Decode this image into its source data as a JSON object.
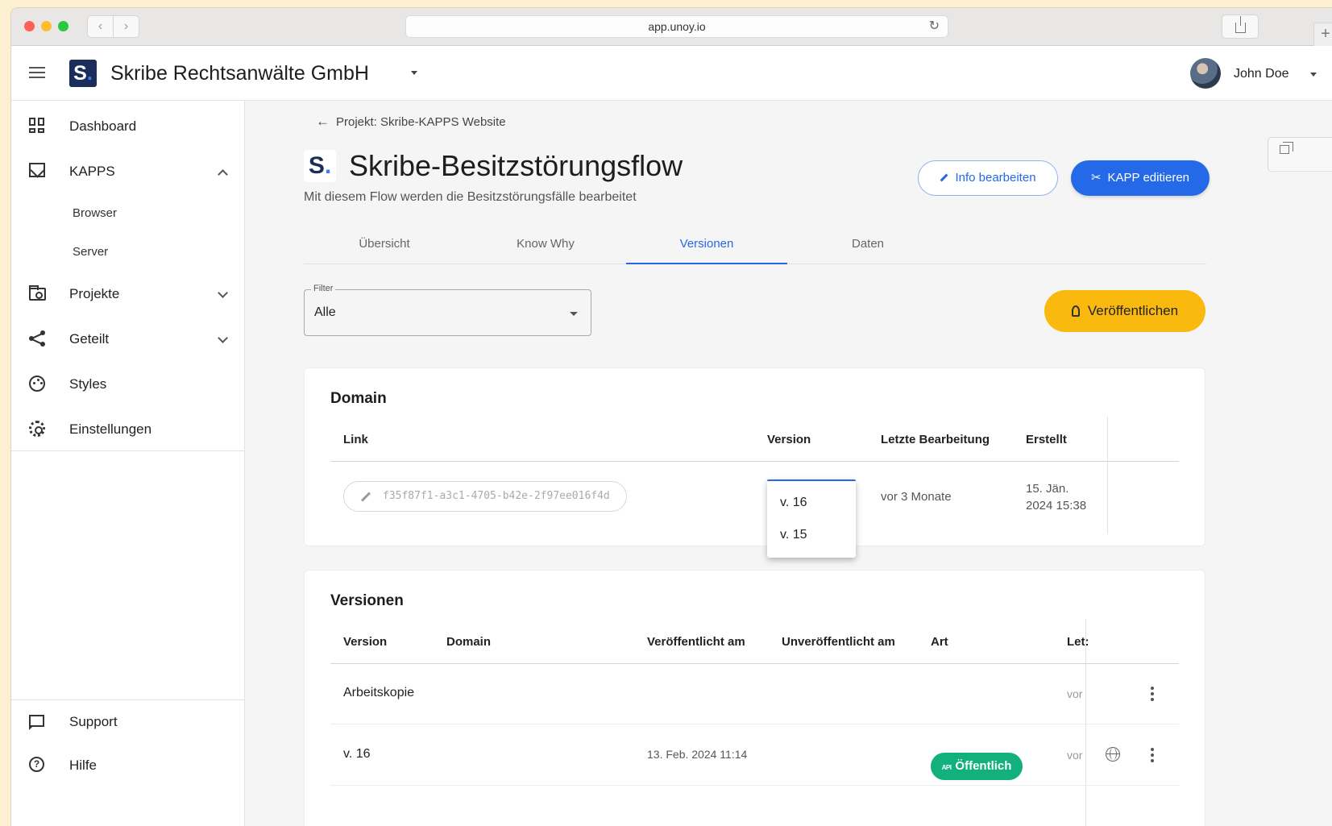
{
  "browser": {
    "url": "app.unoy.io",
    "back_glyph": "‹",
    "forward_glyph": "›",
    "reload_glyph": "↻",
    "new_tab_glyph": "+"
  },
  "header": {
    "logo_letter": "S",
    "logo_dot": ".",
    "org_name": "Skribe Rechtsanwälte GmbH",
    "user_name": "John Doe"
  },
  "sidebar": {
    "items": [
      {
        "label": "Dashboard",
        "icon": "dashboard-icon"
      },
      {
        "label": "KAPPS",
        "icon": "kapps-icon"
      },
      {
        "label": "Projekte",
        "icon": "folder-icon"
      },
      {
        "label": "Geteilt",
        "icon": "share-icon"
      },
      {
        "label": "Styles",
        "icon": "palette-icon"
      },
      {
        "label": "Einstellungen",
        "icon": "gear-icon"
      }
    ],
    "kapps_sub": [
      "Browser",
      "Server"
    ],
    "footer": [
      {
        "label": "Support",
        "icon": "support-icon"
      },
      {
        "label": "Hilfe",
        "icon": "help-icon",
        "glyph": "?"
      }
    ]
  },
  "page": {
    "breadcrumb": "Projekt: Skribe-KAPPS Website",
    "breadcrumb_arrow": "←",
    "title": "Skribe-Besitzstörungsflow",
    "description": "Mit diesem Flow werden die Besitzstörungsfälle bearbeitet",
    "info_button": "Info bearbeiten",
    "kapp_button": "KAPP editieren",
    "kapp_button_glyph": "✂",
    "tabs": [
      "Übersicht",
      "Know Why",
      "Versionen",
      "Daten"
    ],
    "active_tab": "Versionen",
    "filter": {
      "legend": "Filter",
      "value": "Alle"
    },
    "publish_button": "Veröffentlichen"
  },
  "domain_card": {
    "title": "Domain",
    "columns": [
      "Link",
      "Version",
      "Letzte Bearbeitung",
      "Erstellt"
    ],
    "row": {
      "link": "f35f87f1-a3c1-4705-b42e-2f97ee016f4d",
      "last_edit": "vor 3 Monate",
      "created_line1": "15. Jän.",
      "created_line2": "2024 15:38"
    },
    "version_dropdown": [
      "v. 16",
      "v. 15"
    ]
  },
  "versions_card": {
    "title": "Versionen",
    "columns": [
      "Version",
      "Domain",
      "Veröffentlicht am",
      "Unveröffentlicht am",
      "Art",
      "Let:"
    ],
    "rows": [
      {
        "version": "Arbeitskopie",
        "domain": "",
        "published": "",
        "unpublished": "",
        "type": "",
        "last": "vor"
      },
      {
        "version": "v. 16",
        "domain": "",
        "published": "13. Feb. 2024 11:14",
        "unpublished": "",
        "type": "Öffentlich",
        "type_icon_text": "API",
        "last": "vor"
      }
    ],
    "status_color": "#12b07c"
  },
  "colors": {
    "primary": "#2469e8",
    "publish": "#f9b90f",
    "brand": "#1a2e59"
  }
}
